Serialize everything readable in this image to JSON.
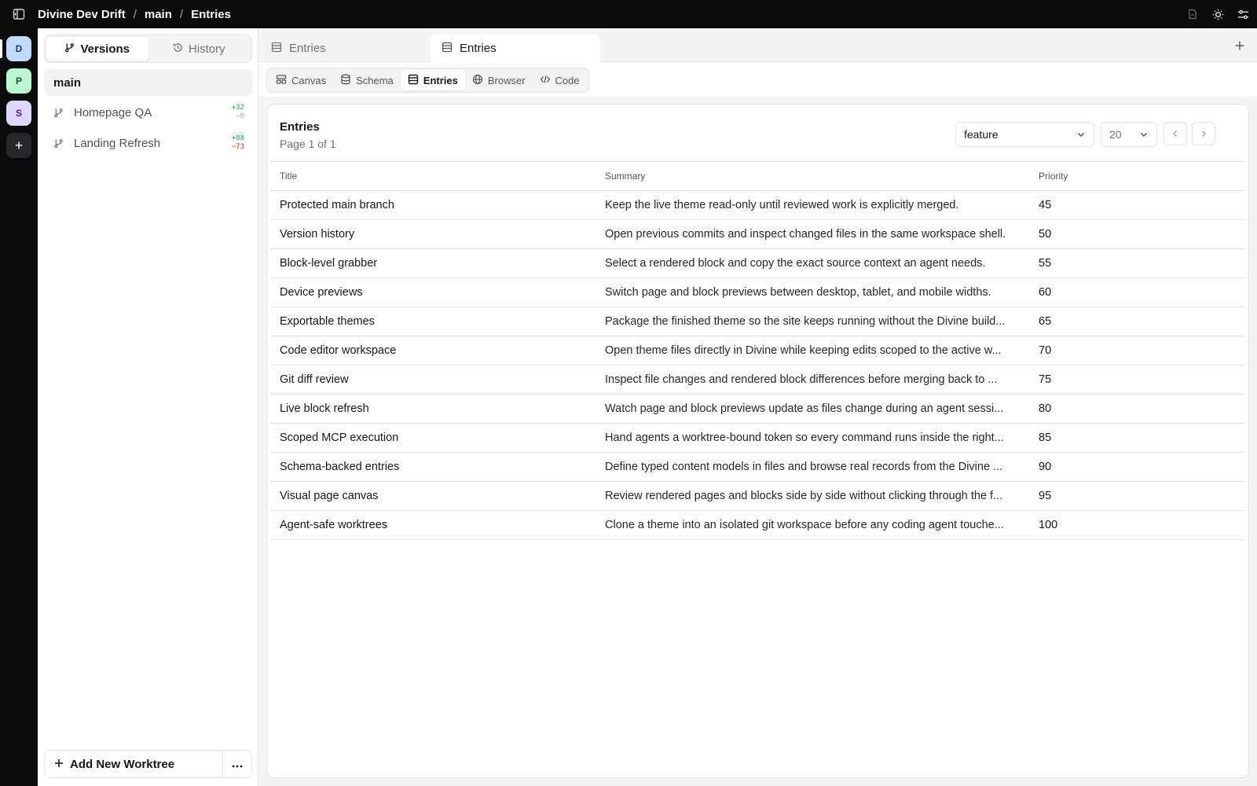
{
  "breadcrumb": {
    "project": "Divine Dev Drift",
    "branch": "main",
    "page": "Entries",
    "separator": "/"
  },
  "top_icons": [
    "file-icon",
    "sun-icon",
    "sliders-icon"
  ],
  "workspaces": [
    {
      "letter": "D",
      "color": "#bfdbfe",
      "text": "#1e3a8a"
    },
    {
      "letter": "P",
      "color": "#bbf7d0",
      "text": "#14532d"
    },
    {
      "letter": "S",
      "color": "#ddd6fe",
      "text": "#4c1d95"
    }
  ],
  "workspace_add": "+",
  "left_panel": {
    "tabs": [
      {
        "label": "Versions",
        "icon": "git-branch-icon"
      },
      {
        "label": "History",
        "icon": "history-icon"
      }
    ],
    "main_branch": "main",
    "branches": [
      {
        "name": "Homepage QA",
        "added": "+32",
        "removed": "−0"
      },
      {
        "name": "Landing Refresh",
        "added": "+88",
        "removed": "−73"
      }
    ],
    "add_worktree": "Add New Worktree"
  },
  "editor_tabs": [
    {
      "label": "Entries"
    },
    {
      "label": "Entries"
    }
  ],
  "view_tabs": [
    {
      "label": "Canvas",
      "icon": "canvas-icon"
    },
    {
      "label": "Schema",
      "icon": "database-icon"
    },
    {
      "label": "Entries",
      "icon": "table-icon"
    },
    {
      "label": "Browser",
      "icon": "globe-icon"
    },
    {
      "label": "Code",
      "icon": "code-icon"
    }
  ],
  "entries_card": {
    "title": "Entries",
    "pagination": "Page 1 of 1",
    "type_filter": "feature",
    "page_size": "20",
    "columns": [
      "Title",
      "Summary",
      "Priority"
    ],
    "rows": [
      {
        "title": "Protected main branch",
        "summary": "Keep the live theme read-only until reviewed work is explicitly merged.",
        "priority": "45"
      },
      {
        "title": "Version history",
        "summary": "Open previous commits and inspect changed files in the same workspace shell.",
        "priority": "50"
      },
      {
        "title": "Block-level grabber",
        "summary": "Select a rendered block and copy the exact source context an agent needs.",
        "priority": "55"
      },
      {
        "title": "Device previews",
        "summary": "Switch page and block previews between desktop, tablet, and mobile widths.",
        "priority": "60"
      },
      {
        "title": "Exportable themes",
        "summary": "Package the finished theme so the site keeps running without the Divine build...",
        "priority": "65"
      },
      {
        "title": "Code editor workspace",
        "summary": "Open theme files directly in Divine while keeping edits scoped to the active w...",
        "priority": "70"
      },
      {
        "title": "Git diff review",
        "summary": "Inspect file changes and rendered block differences before merging back to ...",
        "priority": "75"
      },
      {
        "title": "Live block refresh",
        "summary": "Watch page and block previews update as files change during an agent sessi...",
        "priority": "80"
      },
      {
        "title": "Scoped MCP execution",
        "summary": "Hand agents a worktree-bound token so every command runs inside the right...",
        "priority": "85"
      },
      {
        "title": "Schema-backed entries",
        "summary": "Define typed content models in files and browse real records from the Divine ...",
        "priority": "90"
      },
      {
        "title": "Visual page canvas",
        "summary": "Review rendered pages and blocks side by side without clicking through the f...",
        "priority": "95"
      },
      {
        "title": "Agent-safe worktrees",
        "summary": "Clone a theme into an isolated git workspace before any coding agent touche...",
        "priority": "100"
      }
    ]
  }
}
